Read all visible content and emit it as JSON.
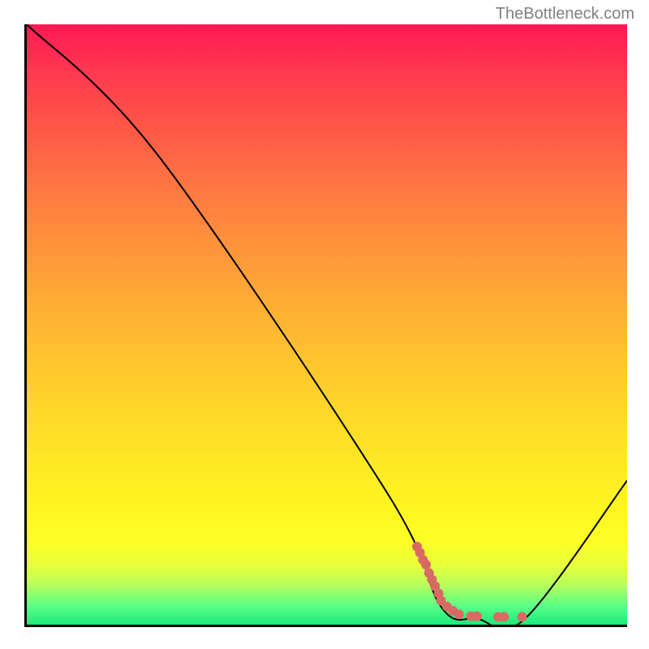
{
  "watermark": "TheBottleneck.com",
  "chart_data": {
    "type": "line",
    "title": "",
    "xlabel": "",
    "ylabel": "",
    "xlim": [
      0,
      100
    ],
    "ylim": [
      0,
      100
    ],
    "series": [
      {
        "name": "curve",
        "points": [
          {
            "x": 0,
            "y": 100
          },
          {
            "x": 22,
            "y": 78
          },
          {
            "x": 60,
            "y": 22
          },
          {
            "x": 69,
            "y": 3
          },
          {
            "x": 75,
            "y": 1
          },
          {
            "x": 83,
            "y": 1
          },
          {
            "x": 100,
            "y": 24
          }
        ]
      }
    ],
    "dots": [
      {
        "x": 65,
        "y": 13
      },
      {
        "x": 65.5,
        "y": 12
      },
      {
        "x": 66,
        "y": 10.8
      },
      {
        "x": 66.5,
        "y": 10
      },
      {
        "x": 67,
        "y": 8.6
      },
      {
        "x": 67.5,
        "y": 7.5
      },
      {
        "x": 68,
        "y": 6.4
      },
      {
        "x": 68.6,
        "y": 5.2
      },
      {
        "x": 69,
        "y": 4
      },
      {
        "x": 70,
        "y": 3
      },
      {
        "x": 71,
        "y": 2.3
      },
      {
        "x": 72,
        "y": 1.7
      },
      {
        "x": 74,
        "y": 1.4
      },
      {
        "x": 75,
        "y": 1.4
      },
      {
        "x": 78.5,
        "y": 1.3
      },
      {
        "x": 79.5,
        "y": 1.3
      },
      {
        "x": 82.5,
        "y": 1.3
      }
    ],
    "gradient_stops": [
      {
        "pos": 0,
        "color": "#ff1953"
      },
      {
        "pos": 1,
        "color": "#1cea79"
      }
    ]
  }
}
